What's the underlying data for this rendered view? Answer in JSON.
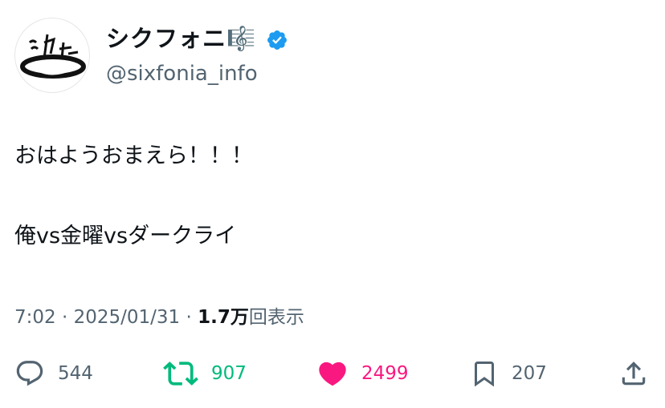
{
  "author": {
    "display_name": "シクフォニ",
    "display_name_emoji": "🎼",
    "handle": "@sixfonia_info",
    "verified": true,
    "verified_color": "#1d9bf0",
    "avatar_text": "シクフォニ"
  },
  "tweet": {
    "line1": "おはようおまえら！！！",
    "line2": "俺vs金曜vsダークライ"
  },
  "meta": {
    "time": "7:02",
    "separator1": " · ",
    "date": "2025/01/31",
    "separator2": " · ",
    "views_count": "1.7万",
    "views_label": "回表示"
  },
  "actions": {
    "reply_count": "544",
    "retweet_count": "907",
    "like_count": "2499",
    "bookmark_count": "207",
    "retweet_color": "#00ba7c",
    "like_color": "#f91880",
    "muted_color": "#536471"
  }
}
